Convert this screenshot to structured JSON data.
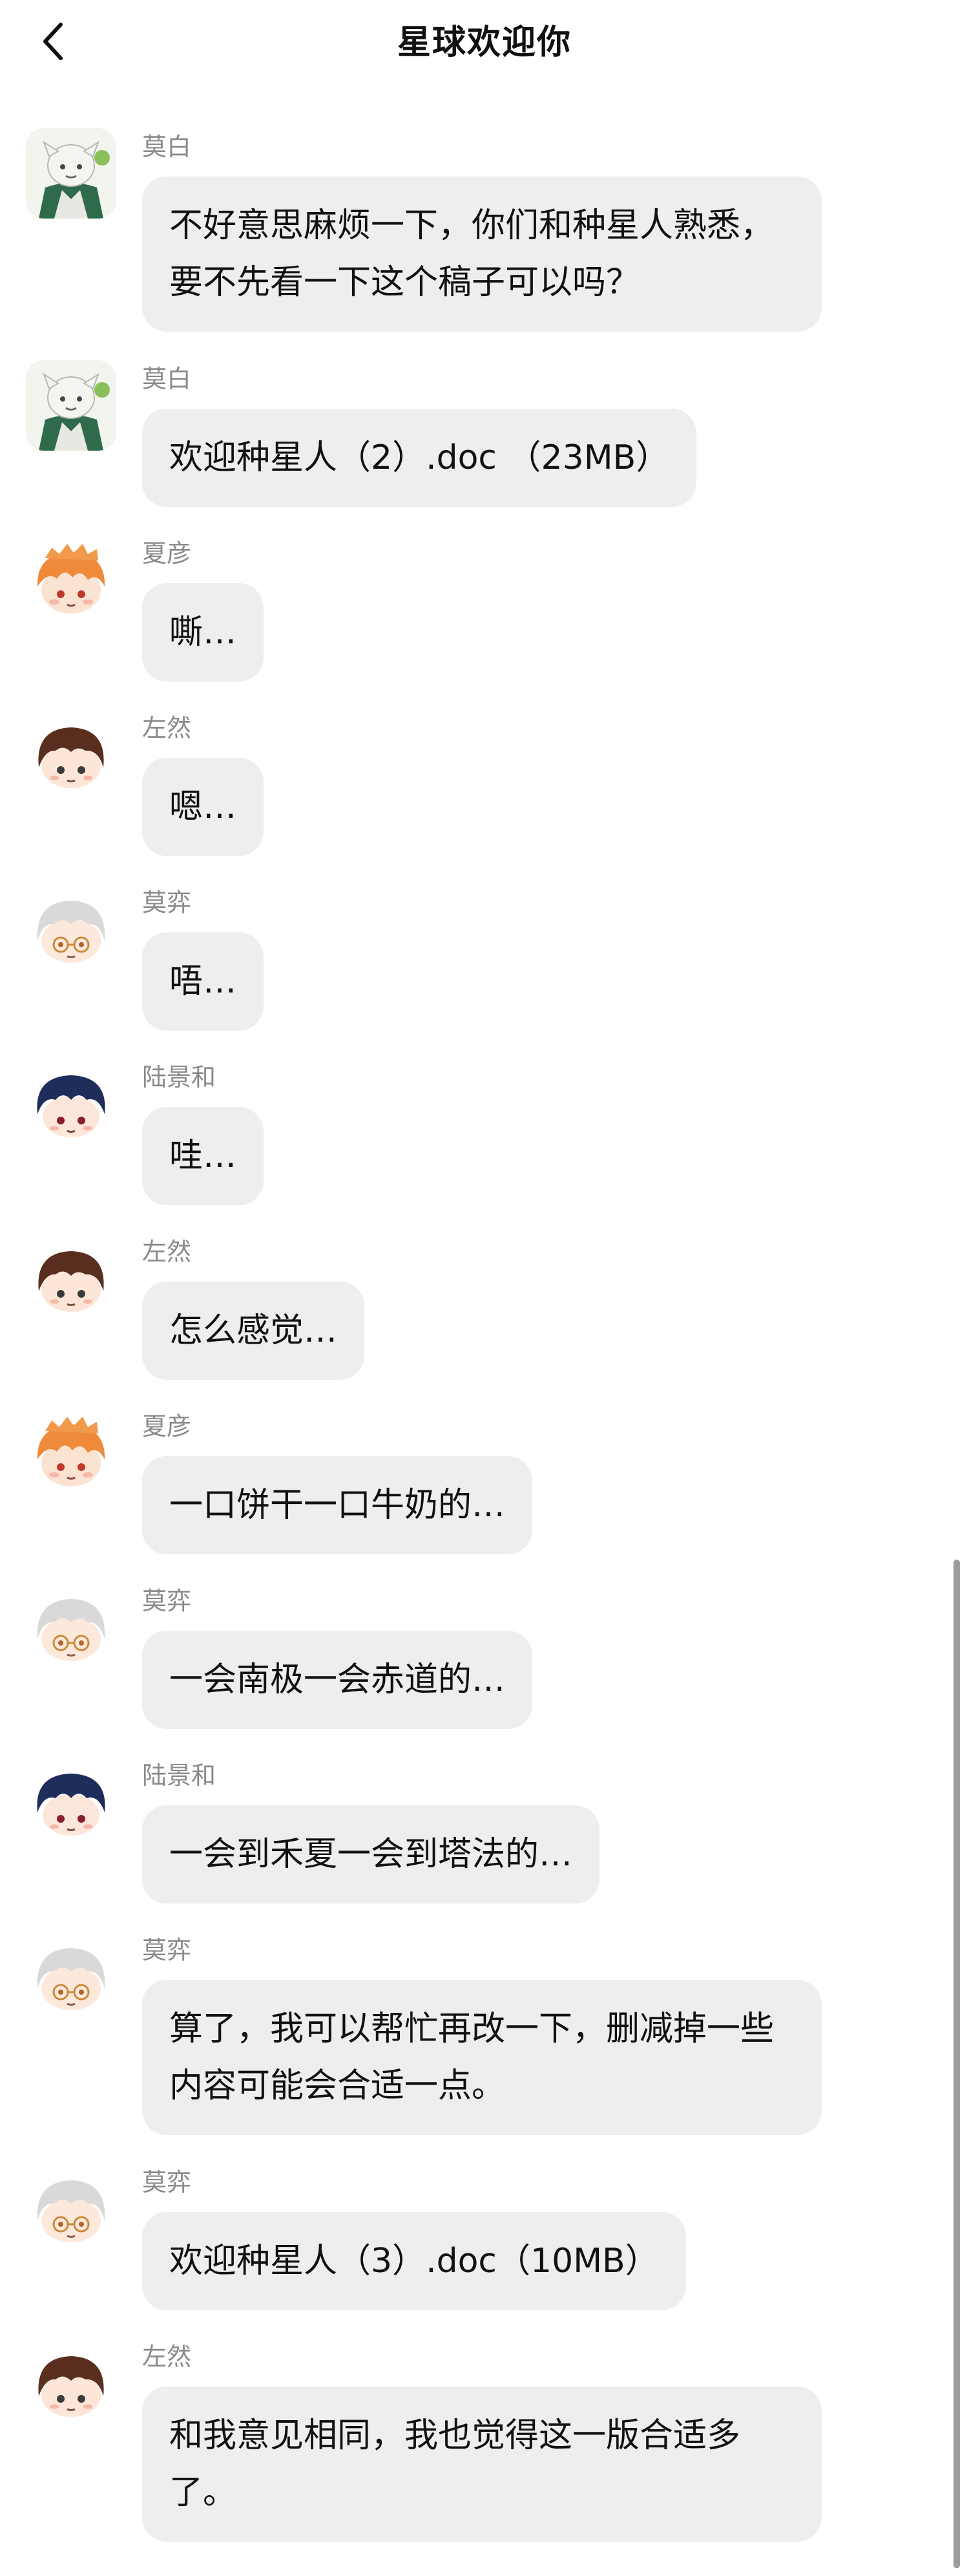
{
  "header": {
    "title": "星球欢迎你",
    "back_icon": "chevron-left-icon"
  },
  "colors": {
    "bubble": "#eeeeee",
    "sender_name": "#8a8a8a",
    "text": "#111111",
    "scrollbar": "#9c9c9c"
  },
  "messages": [
    {
      "sender": "莫白",
      "avatar": "mobai",
      "text": "不好意思麻烦一下，你们和种星人熟悉，要不先看一下这个稿子可以吗？"
    },
    {
      "sender": "莫白",
      "avatar": "mobai",
      "text": "欢迎种星人（2）.doc （23MB）"
    },
    {
      "sender": "夏彦",
      "avatar": "xiayan",
      "text": "嘶…"
    },
    {
      "sender": "左然",
      "avatar": "zuoran",
      "text": "嗯…"
    },
    {
      "sender": "莫弈",
      "avatar": "moyi",
      "text": "唔…"
    },
    {
      "sender": "陆景和",
      "avatar": "lujinghe",
      "text": "哇…"
    },
    {
      "sender": "左然",
      "avatar": "zuoran",
      "text": "怎么感觉…"
    },
    {
      "sender": "夏彦",
      "avatar": "xiayan",
      "text": "一口饼干一口牛奶的…"
    },
    {
      "sender": "莫弈",
      "avatar": "moyi",
      "text": "一会南极一会赤道的…"
    },
    {
      "sender": "陆景和",
      "avatar": "lujinghe",
      "text": "一会到禾夏一会到塔法的…"
    },
    {
      "sender": "莫弈",
      "avatar": "moyi",
      "text": "算了，我可以帮忙再改一下，删减掉一些内容可能会合适一点。"
    },
    {
      "sender": "莫弈",
      "avatar": "moyi",
      "text": "欢迎种星人（3）.doc（10MB）"
    },
    {
      "sender": "左然",
      "avatar": "zuoran",
      "text": "和我意见相同，我也觉得这一版合适多了。"
    }
  ]
}
